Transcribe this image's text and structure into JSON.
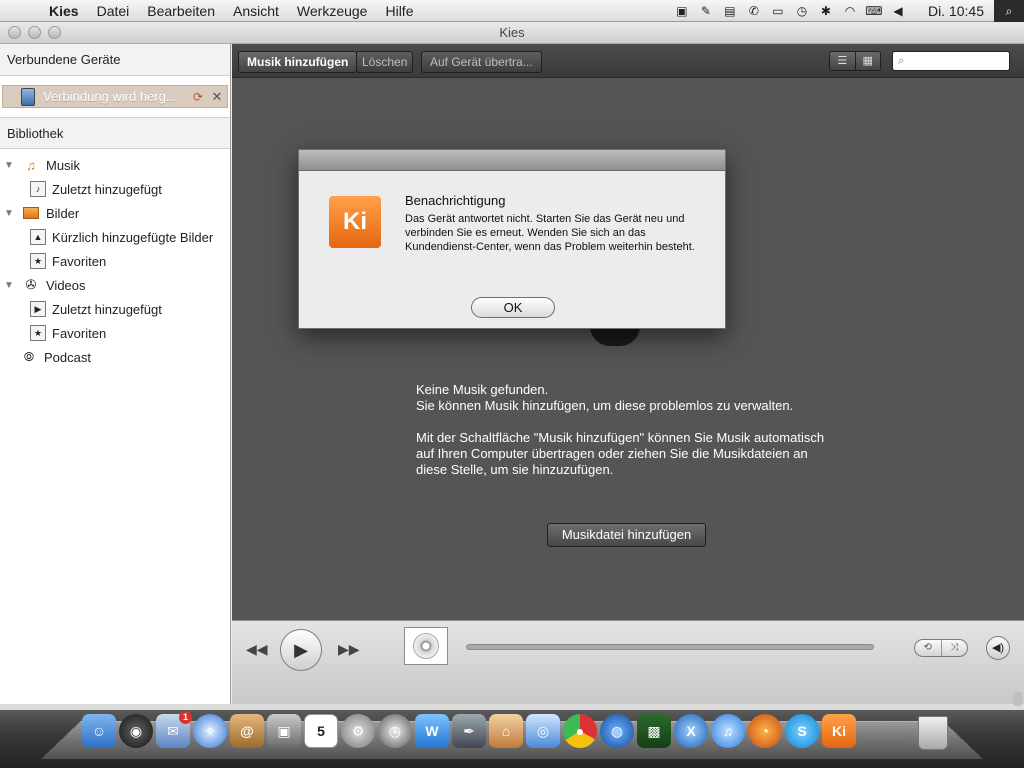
{
  "menubar": {
    "app_name": "Kies",
    "items": [
      "Datei",
      "Bearbeiten",
      "Ansicht",
      "Werkzeuge",
      "Hilfe"
    ],
    "clock": "Di. 10:45"
  },
  "window": {
    "title": "Kies"
  },
  "sidebar": {
    "connected_header": "Verbundene Geräte",
    "device_label": "Verbindung wird herg...",
    "library_header": "Bibliothek",
    "tree": [
      {
        "label": "Musik",
        "level": 0,
        "icon": "music-note-icon",
        "arrow": true
      },
      {
        "label": "Zuletzt hinzugefügt",
        "level": 1,
        "icon": "music-file-icon"
      },
      {
        "label": "Bilder",
        "level": 0,
        "icon": "pictures-icon",
        "arrow": true
      },
      {
        "label": "Kürzlich hinzugefügte Bilder",
        "level": 1,
        "icon": "picture-file-icon"
      },
      {
        "label": "Favoriten",
        "level": 1,
        "icon": "star-icon"
      },
      {
        "label": "Videos",
        "level": 0,
        "icon": "film-reel-icon",
        "arrow": true
      },
      {
        "label": "Zuletzt hinzugefügt",
        "level": 1,
        "icon": "video-file-icon"
      },
      {
        "label": "Favoriten",
        "level": 1,
        "icon": "star-icon"
      },
      {
        "label": "Podcast",
        "level": 0,
        "icon": "podcast-icon",
        "arrow": false
      }
    ]
  },
  "toolbar": {
    "add_music": "Musik hinzufügen",
    "delete": "Löschen",
    "transfer": "Auf Gerät übertra..."
  },
  "content": {
    "empty_line1": "Keine Musik gefunden.",
    "empty_line2": "Sie können Musik hinzufügen, um diese problemlos zu verwalten.",
    "hint": "Mit der Schaltfläche \"Musik hinzufügen\" können Sie Musik automatisch auf Ihren Computer übertragen oder ziehen Sie die Musikdateien an diese Stelle, um sie hinzuzufügen.",
    "add_file_button": "Musikdatei hinzufügen"
  },
  "dialog": {
    "title": "Benachrichtigung",
    "message": "Das Gerät antwortet nicht. Starten Sie das Gerät neu und verbinden Sie es erneut. Wenden Sie sich an das Kundendienst-Center, wenn das Problem weiterhin besteht.",
    "ok": "OK",
    "icon_text": "Ki"
  },
  "dock": {
    "mail_badge": "1",
    "calendar_day": "5",
    "kies_text": "Ki"
  }
}
